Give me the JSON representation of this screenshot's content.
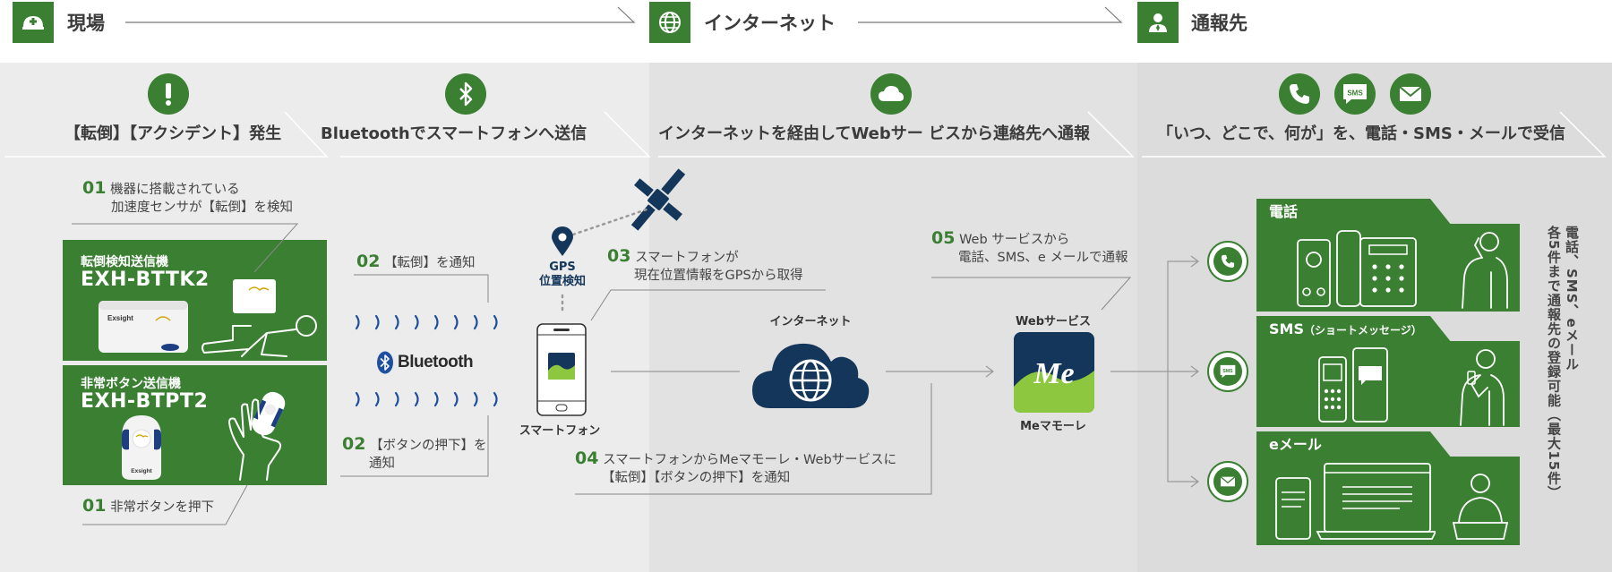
{
  "header": {
    "site_label": "現場",
    "internet_label": "インターネット",
    "destination_label": "通報先"
  },
  "phases": {
    "accident": "【転倒】【アクシデント】発生",
    "bluetooth": "Bluetoothでスマートフォンへ送信",
    "internet": "インターネットを経由してWebサー ビスから連絡先へ通報",
    "receive": "「いつ、どこで、何が」を、電話・SMS・メールで受信"
  },
  "steps": {
    "s01a_num": "01",
    "s01a_line1": "機器に搭載されている",
    "s01a_line2": "加速度センサが【転倒】を検知",
    "s01b_num": "01",
    "s01b_text": "非常ボタンを押下",
    "s02a_num": "02",
    "s02a_text": "【転倒】を通知",
    "s02b_num": "02",
    "s02b_line1": "【ボタンの押下】を",
    "s02b_line2": "通知",
    "s03_num": "03",
    "s03_line1": "スマートフォンが",
    "s03_line2": "現在位置情報をGPSから取得",
    "s04_num": "04",
    "s04_line1": "スマートフォンからMeマモーレ・Webサービスに",
    "s04_line2": "【転倒】【ボタンの押下】を通知",
    "s05_num": "05",
    "s05_line1": "Web サービスから",
    "s05_line2": "電話、SMS、e メールで通報"
  },
  "devices": {
    "fall": {
      "sub": "転倒検知送信機",
      "name": "EXH-BTTK2",
      "brand": "Exsight"
    },
    "button": {
      "sub": "非常ボタン送信機",
      "name": "EXH-BTPT2",
      "brand": "Exsight"
    }
  },
  "labels": {
    "bluetooth_logo": "Bluetooth",
    "gps_line1": "GPS",
    "gps_line2": "位置検知",
    "smartphone": "スマートフォン",
    "internet": "インターネット",
    "web_service": "Webサービス",
    "me_mamore": "Meマモーレ",
    "me_logo": "Me",
    "sms_badge": "SMS"
  },
  "cards": {
    "phone": "電話",
    "sms": "SMS",
    "sms_note": "（ショートメッセージ）",
    "email": "eメール"
  },
  "note_vertical": {
    "line1": "電話、SMS、eメール",
    "line2": "各5件まで通報先の登録可能（最大15件）"
  },
  "colors": {
    "green": "#3a7f32",
    "navy": "#14365a",
    "panel_light": "#ececec",
    "panel_mid": "#e2e2e2",
    "panel_dark": "#dcdcdc",
    "bluetooth_blue": "#1f4fa0"
  }
}
